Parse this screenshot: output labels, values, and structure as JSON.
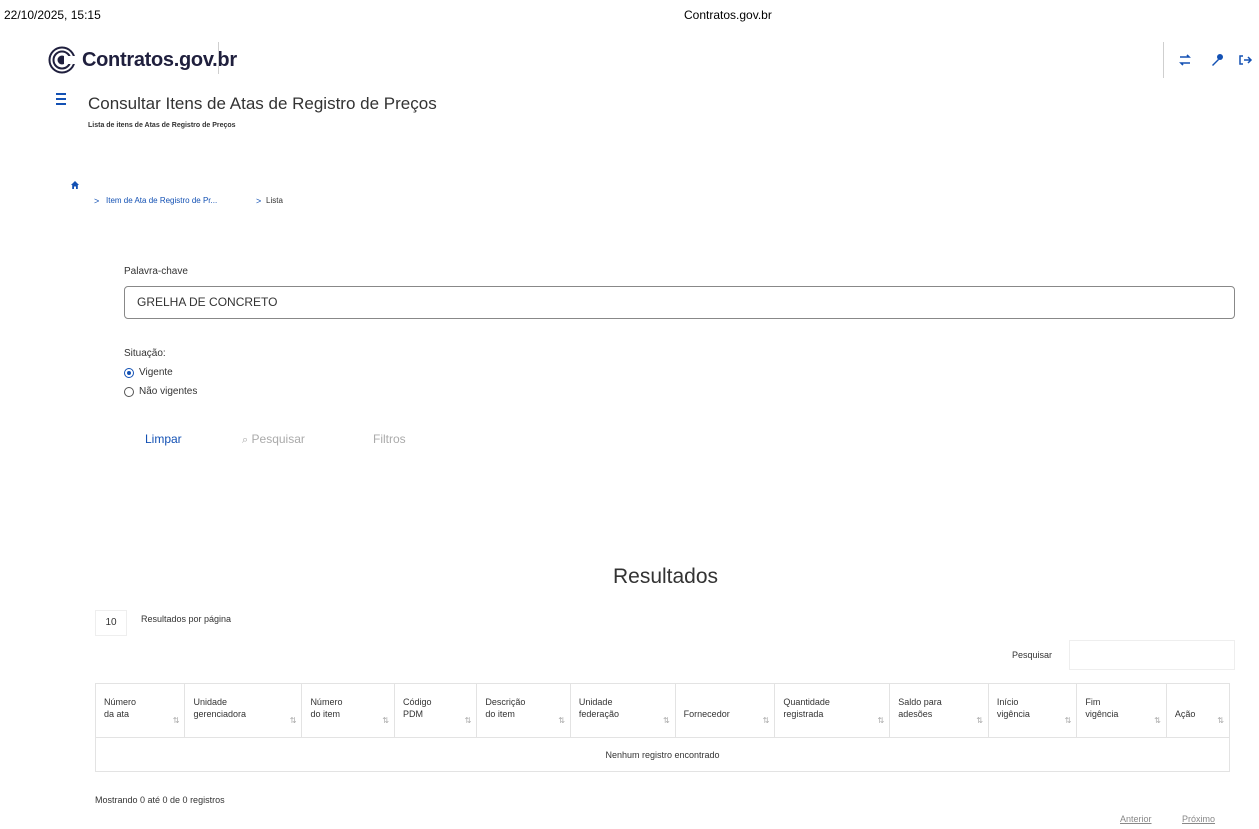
{
  "print_header": {
    "date": "22/10/2025, 15:15",
    "title": "Contratos.gov.br"
  },
  "brand": {
    "name": "Contratos.gov.br",
    "accent": "#1351b4"
  },
  "top_icons": [
    "switch-icon",
    "key-icon",
    "logout-icon"
  ],
  "page": {
    "title": "Consultar Itens de Atas de Registro de Preços",
    "subtitle": "Lista de itens de Atas de Registro de Preços"
  },
  "breadcrumb": {
    "link": "Item de Ata de Registro de Pr...",
    "current": "Lista"
  },
  "form": {
    "keyword_label": "Palavra-chave",
    "keyword_value": "GRELHA DE CONCRETO",
    "situation_label": "Situação:",
    "situation_options": [
      {
        "label": "Vigente",
        "checked": true
      },
      {
        "label": "Não vigentes",
        "checked": false
      }
    ],
    "buttons": {
      "clear": "Limpar",
      "search": "Pesquisar",
      "filters": "Filtros"
    }
  },
  "results": {
    "title": "Resultados",
    "per_page_value": "10",
    "per_page_label": "Resultados por página",
    "search_label": "Pesquisar",
    "columns": [
      [
        "Número",
        "da ata"
      ],
      [
        "Unidade",
        "gerenciadora"
      ],
      [
        "Número",
        "do item"
      ],
      [
        "Código",
        "PDM"
      ],
      [
        "Descrição",
        "do item"
      ],
      [
        "Unidade",
        "federação"
      ],
      [
        "",
        "Fornecedor"
      ],
      [
        "Quantidade",
        "registrada"
      ],
      [
        "Saldo para",
        "adesões"
      ],
      [
        "Início",
        "vigência"
      ],
      [
        "Fim",
        "vigência"
      ],
      [
        "",
        "Ação"
      ]
    ],
    "empty_message": "Nenhum registro encontrado",
    "info": "Mostrando 0 até 0 de 0 registros",
    "prev": "Anterior",
    "next": "Próximo"
  }
}
